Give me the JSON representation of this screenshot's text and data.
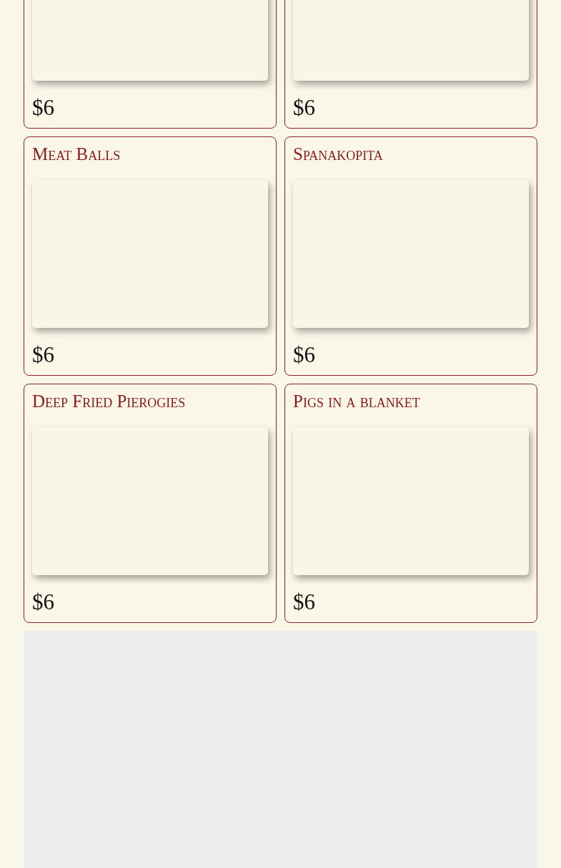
{
  "items": [
    {
      "price": "$6"
    },
    {
      "price": "$6"
    },
    {
      "title": "Meat Balls",
      "price": "$6"
    },
    {
      "title": "Spanakopita",
      "price": "$6"
    },
    {
      "title": "Deep Fried Pierogies",
      "price": "$6"
    },
    {
      "title": "Pigs in a blanket",
      "price": "$6"
    }
  ]
}
